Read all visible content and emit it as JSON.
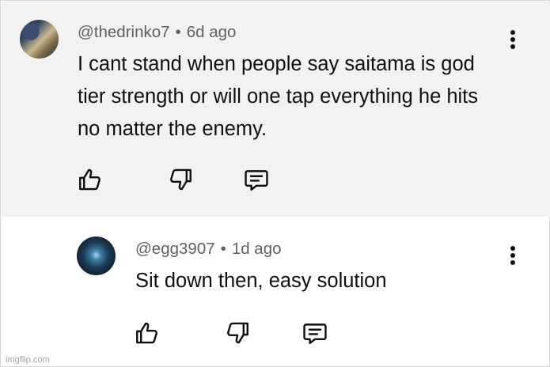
{
  "comments": [
    {
      "handle": "@thedrinko7",
      "separator": "•",
      "time": "6d ago",
      "text": "I cant stand when people say saitama is god tier strength or will one tap everything he hits no matter the enemy."
    },
    {
      "handle": "@egg3907",
      "separator": "•",
      "time": "1d ago",
      "text": "Sit down then, easy solution"
    }
  ],
  "watermark": "imgflip.com",
  "icons": {
    "like": "thumbs-up-icon",
    "dislike": "thumbs-down-icon",
    "reply": "reply-comment-icon",
    "more": "more-vertical-icon"
  },
  "colors": {
    "highlight_background": "#f2f2f2",
    "meta_text": "#606060",
    "body_text": "#0f0f0f"
  }
}
